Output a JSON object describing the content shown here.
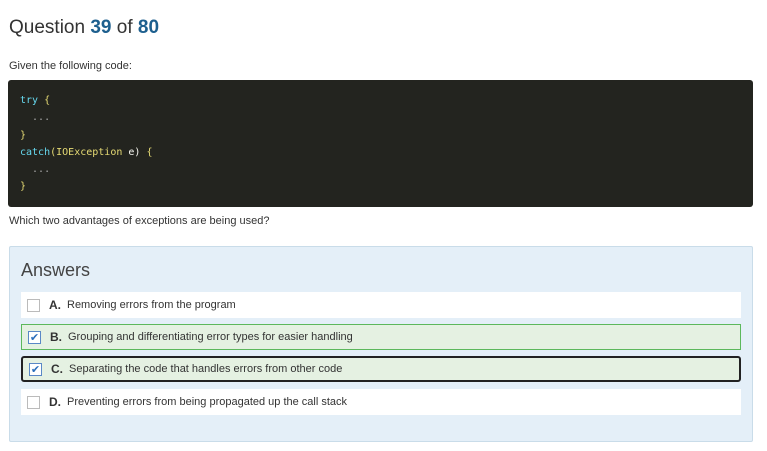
{
  "header": {
    "prefix": "Question",
    "current": "39",
    "of": "of",
    "total": "80"
  },
  "intro": "Given the following code:",
  "code": {
    "l1_kw": "try",
    "l1_br": " {",
    "l2": "  ...",
    "l3": "}",
    "l4_kw": "catch",
    "l4_p1": "(",
    "l4_ty": "IOException",
    "l4_p2": " e) ",
    "l4_br": "{",
    "l5": "  ...",
    "l6": "}"
  },
  "prompt": "Which two advantages of exceptions are being used?",
  "answers": {
    "title": "Answers",
    "options": [
      {
        "letter": "A.",
        "text": "Removing errors from the program",
        "checked": false
      },
      {
        "letter": "B.",
        "text": "Grouping and differentiating error types for easier handling",
        "checked": true
      },
      {
        "letter": "C.",
        "text": "Separating the code that handles errors from other code",
        "checked": true
      },
      {
        "letter": "D.",
        "text": "Preventing errors from being propagated up the call stack",
        "checked": false
      }
    ],
    "check_glyph": "✔"
  },
  "colors": {
    "accent": "#1d5f8e",
    "selected_border": "#5cb85c",
    "panel_bg": "#e4eff8",
    "code_bg": "#23241f"
  }
}
